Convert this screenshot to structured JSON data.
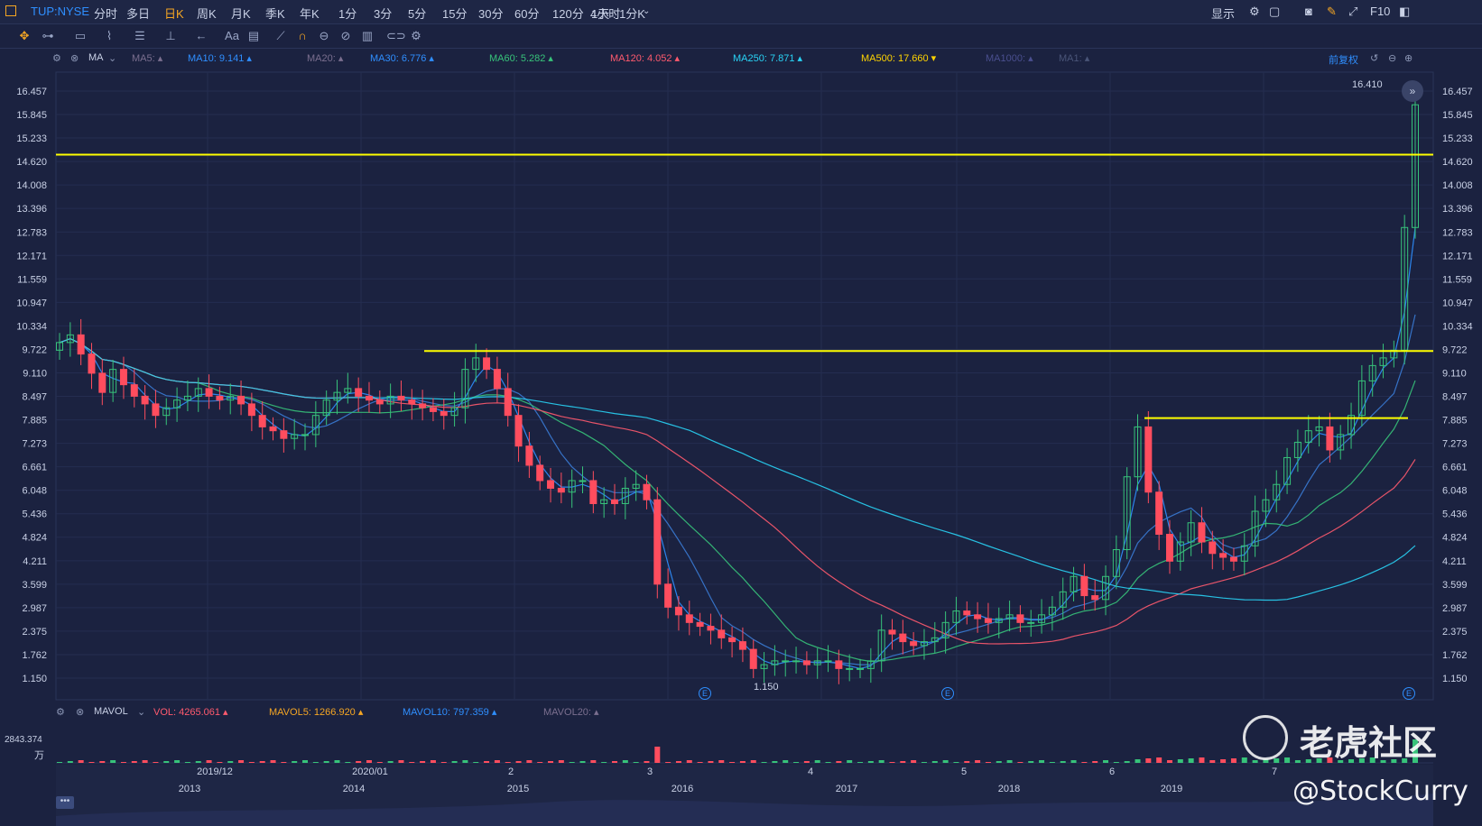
{
  "topbar": {
    "symbol": "TUP:NYSE",
    "periods": [
      "分时",
      "多日",
      "日K",
      "周K",
      "月K",
      "季K",
      "年K",
      "1分",
      "3分",
      "5分",
      "15分",
      "30分",
      "60分",
      "120分",
      "4小时"
    ],
    "active_period": "日K",
    "interval": "1天 : 1分K",
    "display_label": "显示",
    "f10_label": "F10"
  },
  "ma_bar": {
    "name": "MA",
    "items": [
      {
        "label": "MA5:",
        "color": "#7b6f8f"
      },
      {
        "label": "MA10: 9.141",
        "color": "#2f8fff"
      },
      {
        "label": "MA20:",
        "color": "#7b6f8f"
      },
      {
        "label": "MA30: 6.776",
        "color": "#2f8fff"
      },
      {
        "label": "MA60: 5.282",
        "color": "#37c37a"
      },
      {
        "label": "MA120: 4.052",
        "color": "#ff5a6e"
      },
      {
        "label": "MA250: 7.871",
        "color": "#29d3f5"
      },
      {
        "label": "MA500: 17.660",
        "color": "#ffd400"
      },
      {
        "label": "MA1000:",
        "color": "#4a4f8f"
      },
      {
        "label": "MA1:",
        "color": "#4a5578"
      }
    ],
    "adjust_label": "前复权"
  },
  "price_axis": [
    "16.457",
    "15.845",
    "15.233",
    "14.620",
    "14.008",
    "13.396",
    "12.783",
    "12.171",
    "11.559",
    "10.947",
    "10.334",
    "9.722",
    "9.110",
    "8.497",
    "7.885",
    "7.273",
    "6.661",
    "6.048",
    "5.436",
    "4.824",
    "4.211",
    "3.599",
    "2.987",
    "2.375",
    "1.762",
    "1.150"
  ],
  "annotations": {
    "high": "16.410",
    "low": "1.150",
    "earnings_marker": "E"
  },
  "vol_bar": {
    "name": "MAVOL",
    "items": [
      {
        "label": "VOL: 4265.061",
        "color": "#ff5a6e"
      },
      {
        "label": "MAVOL5: 1266.920",
        "color": "#f5a623"
      },
      {
        "label": "MAVOL10: 797.359",
        "color": "#2f8fff"
      },
      {
        "label": "MAVOL20:",
        "color": "#7b6f8f"
      }
    ],
    "axis_top": "2843.374",
    "axis_unit": "万"
  },
  "x_axis": {
    "top_labels": [
      "2019/12",
      "2020/01",
      "2",
      "3",
      "4",
      "5",
      "6",
      "7"
    ],
    "overview_labels": [
      "2013",
      "2014",
      "2015",
      "2016",
      "2017",
      "2018",
      "2019"
    ]
  },
  "watermark": {
    "brand": "老虎社区",
    "handle": "@StockCurry"
  },
  "colors": {
    "up": "#37c37a",
    "down": "#ff4d5e",
    "resistance": "#ffff00",
    "bg": "#1b2240"
  },
  "chart_data": {
    "type": "candlestick",
    "title": "",
    "ylim": [
      1.15,
      16.457
    ],
    "resistance_levels": [
      14.8,
      9.68,
      7.93
    ],
    "close": [
      9.9,
      10.1,
      9.6,
      9.1,
      8.6,
      9.2,
      8.8,
      8.5,
      8.3,
      8.0,
      8.2,
      8.4,
      8.5,
      8.7,
      8.5,
      8.4,
      8.5,
      8.3,
      8.0,
      7.7,
      7.6,
      7.4,
      7.5,
      7.5,
      8.0,
      8.4,
      8.6,
      8.7,
      8.5,
      8.4,
      8.3,
      8.5,
      8.4,
      8.3,
      8.2,
      8.1,
      8.0,
      8.2,
      9.2,
      9.5,
      9.2,
      8.7,
      8.0,
      7.2,
      6.7,
      6.3,
      6.1,
      6.0,
      6.3,
      6.3,
      5.7,
      5.8,
      5.7,
      6.1,
      6.2,
      5.8,
      3.6,
      3.0,
      2.8,
      2.6,
      2.5,
      2.4,
      2.2,
      2.1,
      1.9,
      1.4,
      1.5,
      1.6,
      1.6,
      1.6,
      1.5,
      1.6,
      1.6,
      1.4,
      1.4,
      1.4,
      1.6,
      2.4,
      2.3,
      2.1,
      2.0,
      2.1,
      2.2,
      2.6,
      2.9,
      2.8,
      2.7,
      2.6,
      2.7,
      2.8,
      2.6,
      2.6,
      2.8,
      3.0,
      3.4,
      3.8,
      3.3,
      3.2,
      3.8,
      4.5,
      6.4,
      7.7,
      6.0,
      4.9,
      4.2,
      4.7,
      5.2,
      4.7,
      4.4,
      4.3,
      4.2,
      4.6,
      5.5,
      5.8,
      6.2,
      6.9,
      7.3,
      7.6,
      7.7,
      7.1,
      7.5,
      8.0,
      8.9,
      9.3,
      9.5,
      9.7,
      12.9,
      16.1
    ],
    "ma_lines_legend": [
      "MA10",
      "MA30",
      "MA60",
      "MA120",
      "MA250"
    ]
  }
}
